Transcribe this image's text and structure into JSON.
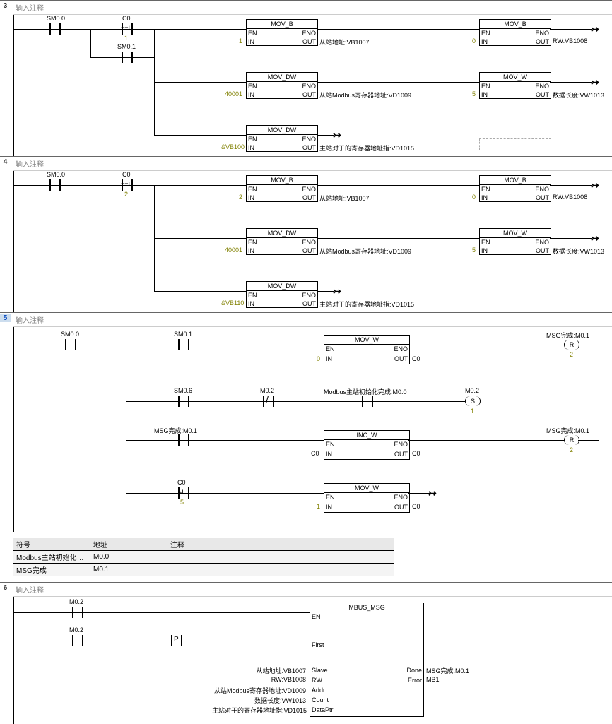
{
  "comment_text": "输入注释",
  "networks": [
    {
      "num": "3",
      "highlighted": false
    },
    {
      "num": "4",
      "highlighted": false
    },
    {
      "num": "5",
      "highlighted": true
    },
    {
      "num": "6",
      "highlighted": false
    }
  ],
  "n3": {
    "sm00": "SM0.0",
    "c0": "C0",
    "c0_op": "==I",
    "c0_val": "1",
    "sm01": "SM0.1",
    "movb_in": "1",
    "movb_out": "从站地址:VB1007",
    "movb2_in": "0",
    "movb2_out": "RW:VB1008",
    "movdw_in": "40001",
    "movdw_out": "从站Modbus寄存器地址:VD1009",
    "movw_in": "5",
    "movw_out": "数据长度:VW1013",
    "movdw2_in": "&VB100",
    "movdw2_out": "主站对于的寄存器地址指:VD1015"
  },
  "n4": {
    "sm00": "SM0.0",
    "c0": "C0",
    "c0_op": "==I",
    "c0_val": "2",
    "movb_in": "2",
    "movb_out": "从站地址:VB1007",
    "movb2_in": "0",
    "movb2_out": "RW:VB1008",
    "movdw_in": "40001",
    "movdw_out": "从站Modbus寄存器地址:VD1009",
    "movw_in": "5",
    "movw_out": "数据长度:VW1013",
    "movdw2_in": "&VB110",
    "movdw2_out": "主站对于的寄存器地址指:VD1015"
  },
  "n5": {
    "sm00": "SM0.0",
    "sm01": "SM0.1",
    "sm06": "SM0.6",
    "m02": "M0.2",
    "msg_done": "MSG完成:M0.1",
    "mb_init": "Modbus主站初始化完成:M0.0",
    "c0": "C0",
    "c0_gt": ">I",
    "c0_gt_val": "5",
    "movw_in": "0",
    "movw_out": "C0",
    "incw_in": "C0",
    "incw_out": "C0",
    "movw2_in": "1",
    "movw2_out": "C0",
    "coil_r": "R",
    "coil_r_n": "2",
    "coil_s": "S",
    "coil_s_n": "1"
  },
  "symbol_table": {
    "headers": [
      "符号",
      "地址",
      "注释"
    ],
    "rows": [
      [
        "Modbus主站初始化…",
        "M0.0",
        ""
      ],
      [
        "MSG完成",
        "M0.1",
        ""
      ]
    ]
  },
  "n6": {
    "m02": "M0.2",
    "box": "MBUS_MSG",
    "slave": "从站地址:VB1007",
    "slave_pin": "Slave",
    "rw": "RW:VB1008",
    "rw_pin": "RW",
    "addr": "从站Modbus寄存器地址:VD1009",
    "addr_pin": "Addr",
    "count": "数据长度:VW1013",
    "count_pin": "Count",
    "ptr": "主站对于的寄存器地址指:VD1015",
    "ptr_pin": "DataPtr",
    "done": "Done",
    "done_out": "MSG完成:M0.1",
    "error": "Error",
    "error_out": "MB1",
    "en": "EN",
    "first": "First"
  },
  "box_labels": {
    "mov_b": "MOV_B",
    "mov_w": "MOV_W",
    "mov_dw": "MOV_DW",
    "inc_w": "INC_W",
    "en": "EN",
    "eno": "ENO",
    "in": "IN",
    "out": "OUT"
  }
}
